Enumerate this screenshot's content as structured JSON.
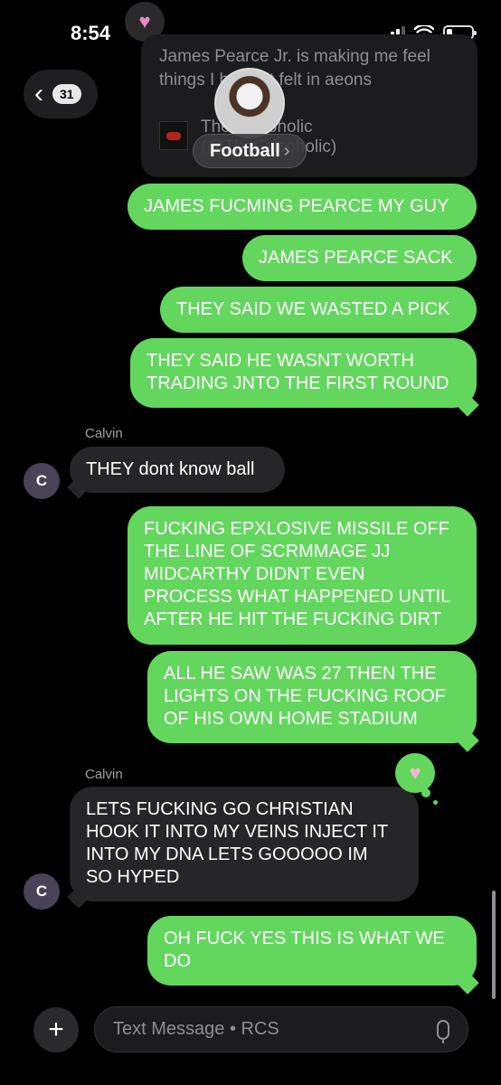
{
  "status_bar": {
    "time": "8:54"
  },
  "header": {
    "back_count": "31",
    "tapback_top_icon": "heart-icon"
  },
  "embed": {
    "text": "James Pearce Jr. is making me feel things I haven't felt in aeons",
    "account": "The Falcoholic\n(@TheFalcoholic)",
    "topic_pill": "Football"
  },
  "messages": {
    "m1": "JAMES FUCMING PEARCE MY GUY",
    "m2": "JAMES PEARCE SACK",
    "m3": "THEY SAID WE WASTED A PICK",
    "m4": "THEY SAID HE WASNT WORTH\nTRADING JNTO THE FIRST ROUND",
    "sender1": "Calvin",
    "m5": "THEY dont know ball",
    "m6": "FUCKING EPXLOSIVE MISSILE OFF\nTHE LINE OF SCRMMAGE JJ\nMIDCARTHY DIDNT EVEN\nPROCESS WHAT HAPPENED UNTIL\nAFTER HE HIT THE FUCKING DIRT",
    "m7": "ALL HE SAW WAS 27 THEN THE\nLIGHTS ON THE FUCKING ROOF\nOF HIS OWN HOME STADIUM",
    "sender2": "Calvin",
    "m8": "LETS FUCKING GO CHRISTIAN\nHOOK IT INTO MY VEINS INJECT IT\nINTO MY DNA LETS GOOOOO IM\nSO HYPED",
    "m9": "OH FUCK YES THIS IS WHAT WE\nDO"
  },
  "contact": {
    "initial": "C"
  },
  "composer": {
    "placeholder": "Text Message • RCS"
  },
  "colors": {
    "outgoing": "#63d65e",
    "incoming": "#262628",
    "background": "#000000"
  }
}
